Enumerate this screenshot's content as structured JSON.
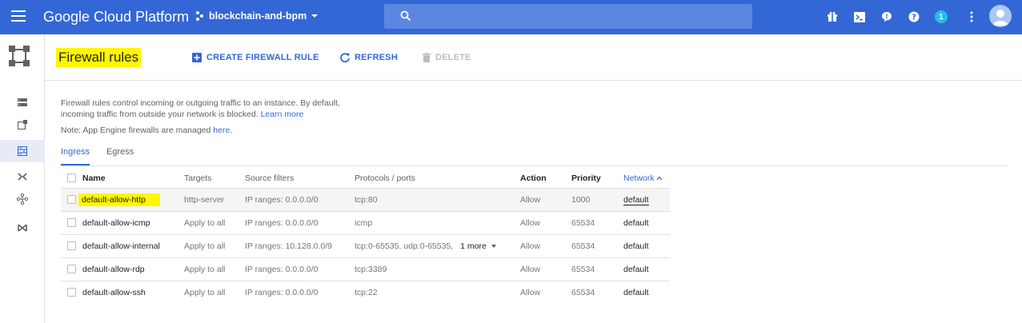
{
  "topbar": {
    "brand": "Google Cloud Platform",
    "project": "blockchain-and-bpm",
    "notification_count": "1",
    "icons": [
      "gift-icon",
      "cloud-shell-icon",
      "feedback-icon",
      "help-icon",
      "notifications-badge",
      "more-vert-icon",
      "account-avatar"
    ]
  },
  "leftnav": {
    "items": [
      "vm-instances-icon",
      "external-link-icon",
      "firewall-icon",
      "routes-icon",
      "vpc-peering-icon",
      "interconnect-icon"
    ]
  },
  "header": {
    "title": "Firewall rules",
    "create_label": "CREATE FIREWALL RULE",
    "refresh_label": "REFRESH",
    "delete_label": "DELETE"
  },
  "description": {
    "text": "Firewall rules control incoming or outgoing traffic to an instance. By default, incoming traffic from outside your network is blocked.",
    "learn_more": "Learn more",
    "note_prefix": "Note: App Engine firewalls are managed",
    "note_link": "here",
    "note_suffix": "."
  },
  "tabs": [
    {
      "label": "Ingress",
      "active": true
    },
    {
      "label": "Egress",
      "active": false
    }
  ],
  "table": {
    "columns": {
      "name": "Name",
      "targets": "Targets",
      "source_filters": "Source filters",
      "protocols": "Protocols / ports",
      "action": "Action",
      "priority": "Priority",
      "network": "Network"
    },
    "rows": [
      {
        "name": "default-allow-http",
        "targets": "http-server",
        "source": "IP ranges: 0.0.0.0/0",
        "protocols": "tcp:80",
        "more": "",
        "action": "Allow",
        "priority": "1000",
        "network": "default"
      },
      {
        "name": "default-allow-icmp",
        "targets": "Apply to all",
        "source": "IP ranges: 0.0.0.0/0",
        "protocols": "icmp",
        "more": "",
        "action": "Allow",
        "priority": "65534",
        "network": "default"
      },
      {
        "name": "default-allow-internal",
        "targets": "Apply to all",
        "source": "IP ranges: 10.128.0.0/9",
        "protocols": "tcp:0-65535, udp:0-65535,",
        "more": "1 more",
        "action": "Allow",
        "priority": "65534",
        "network": "default"
      },
      {
        "name": "default-allow-rdp",
        "targets": "Apply to all",
        "source": "IP ranges: 0.0.0.0/0",
        "protocols": "tcp:3389",
        "more": "",
        "action": "Allow",
        "priority": "65534",
        "network": "default"
      },
      {
        "name": "default-allow-ssh",
        "targets": "Apply to all",
        "source": "IP ranges: 0.0.0.0/0",
        "protocols": "tcp:22",
        "more": "",
        "action": "Allow",
        "priority": "65534",
        "network": "default"
      }
    ]
  },
  "colors": {
    "topbar": "#3367d6",
    "accent": "#3367d6",
    "highlight": "#fff600",
    "badge": "#22c1e8"
  }
}
